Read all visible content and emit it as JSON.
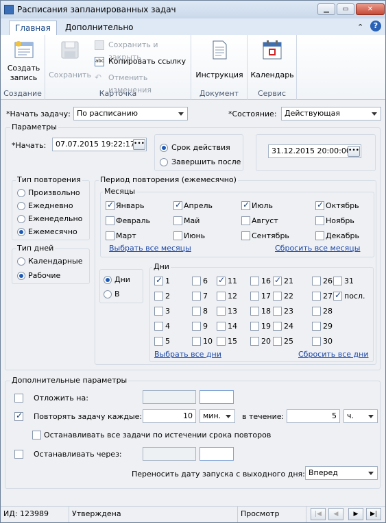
{
  "window": {
    "title": "Расписания запланированных задач"
  },
  "tabs": [
    "Главная",
    "Дополнительно"
  ],
  "ribbon": {
    "create_label_1": "Создать",
    "create_label_2": "запись",
    "save": "Сохранить",
    "save_close": "Сохранить и закрыть",
    "copy_link": "Копировать ссылку",
    "cancel_changes": "Отменить изменения",
    "instruction": "Инструкция",
    "calendar": "Календарь",
    "group_create": "Создание",
    "group_card": "Карточка",
    "group_document": "Документ",
    "group_service": "Сервис"
  },
  "top": {
    "start_task_label": "*Начать задачу:",
    "start_task_value": "По расписанию",
    "state_label": "*Состояние:",
    "state_value": "Действующая"
  },
  "params": {
    "title": "Параметры",
    "start_label": "*Начать:",
    "start_value": "07.07.2015 19:22:17",
    "validity_label": "Срок действия",
    "finish_after_label": "Завершить после",
    "end_value": "31.12.2015 20:00:00"
  },
  "repeat_type": {
    "title": "Тип повторения",
    "options": [
      "Произвольно",
      "Ежедневно",
      "Еженедельно",
      "Ежемесячно"
    ],
    "selected": 3
  },
  "day_type": {
    "title": "Тип дней",
    "options": [
      "Календарные",
      "Рабочие"
    ],
    "selected": 1
  },
  "period": {
    "title": "Период повторения (ежемесячно)",
    "months_title": "Месяцы",
    "months": [
      {
        "label": "Январь",
        "checked": true
      },
      {
        "label": "Февраль",
        "checked": false
      },
      {
        "label": "Март",
        "checked": false
      },
      {
        "label": "Апрель",
        "checked": true
      },
      {
        "label": "Май",
        "checked": false
      },
      {
        "label": "Июнь",
        "checked": false
      },
      {
        "label": "Июль",
        "checked": true
      },
      {
        "label": "Август",
        "checked": false
      },
      {
        "label": "Сентябрь",
        "checked": false
      },
      {
        "label": "Октябрь",
        "checked": true
      },
      {
        "label": "Ноябрь",
        "checked": false
      },
      {
        "label": "Декабрь",
        "checked": false
      }
    ],
    "select_all_months": "Выбрать все месяцы",
    "reset_all_months": "Сбросить все месяцы",
    "days_mode": [
      "Дни",
      "В"
    ],
    "days_title": "Дни",
    "days": [
      {
        "label": "1",
        "checked": true
      },
      {
        "label": "2",
        "checked": false
      },
      {
        "label": "3",
        "checked": false
      },
      {
        "label": "4",
        "checked": false
      },
      {
        "label": "5",
        "checked": false
      },
      {
        "label": "6",
        "checked": false
      },
      {
        "label": "7",
        "checked": false
      },
      {
        "label": "8",
        "checked": false
      },
      {
        "label": "9",
        "checked": false
      },
      {
        "label": "10",
        "checked": false
      },
      {
        "label": "11",
        "checked": true
      },
      {
        "label": "12",
        "checked": false
      },
      {
        "label": "13",
        "checked": false
      },
      {
        "label": "14",
        "checked": false
      },
      {
        "label": "15",
        "checked": false
      },
      {
        "label": "16",
        "checked": false
      },
      {
        "label": "17",
        "checked": false
      },
      {
        "label": "18",
        "checked": false
      },
      {
        "label": "19",
        "checked": false
      },
      {
        "label": "20",
        "checked": false
      },
      {
        "label": "21",
        "checked": true
      },
      {
        "label": "22",
        "checked": false
      },
      {
        "label": "23",
        "checked": false
      },
      {
        "label": "24",
        "checked": false
      },
      {
        "label": "25",
        "checked": false
      },
      {
        "label": "26",
        "checked": false
      },
      {
        "label": "27",
        "checked": false
      },
      {
        "label": "28",
        "checked": false
      },
      {
        "label": "29",
        "checked": false
      },
      {
        "label": "30",
        "checked": false
      },
      {
        "label": "31",
        "checked": false
      },
      {
        "label": "посл.",
        "checked": true
      }
    ],
    "select_all_days": "Выбрать все дни",
    "reset_all_days": "Сбросить все дни"
  },
  "extra": {
    "title": "Дополнительные параметры",
    "postpone_label": "Отложить на:",
    "repeat_label": "Повторять задачу каждые:",
    "repeat_value": "10",
    "repeat_unit": "мин.",
    "during_label": "в течение:",
    "during_value": "5",
    "during_unit": "ч.",
    "stop_all_label": "Останавливать все задачи по истечении срока повторов",
    "stop_after_label": "Останавливать через:",
    "move_label": "Переносить дату запуска с выходного дня:",
    "move_value": "Вперед"
  },
  "status": {
    "id": "ИД: 123989",
    "state": "Утверждена",
    "mode": "Просмотр"
  }
}
